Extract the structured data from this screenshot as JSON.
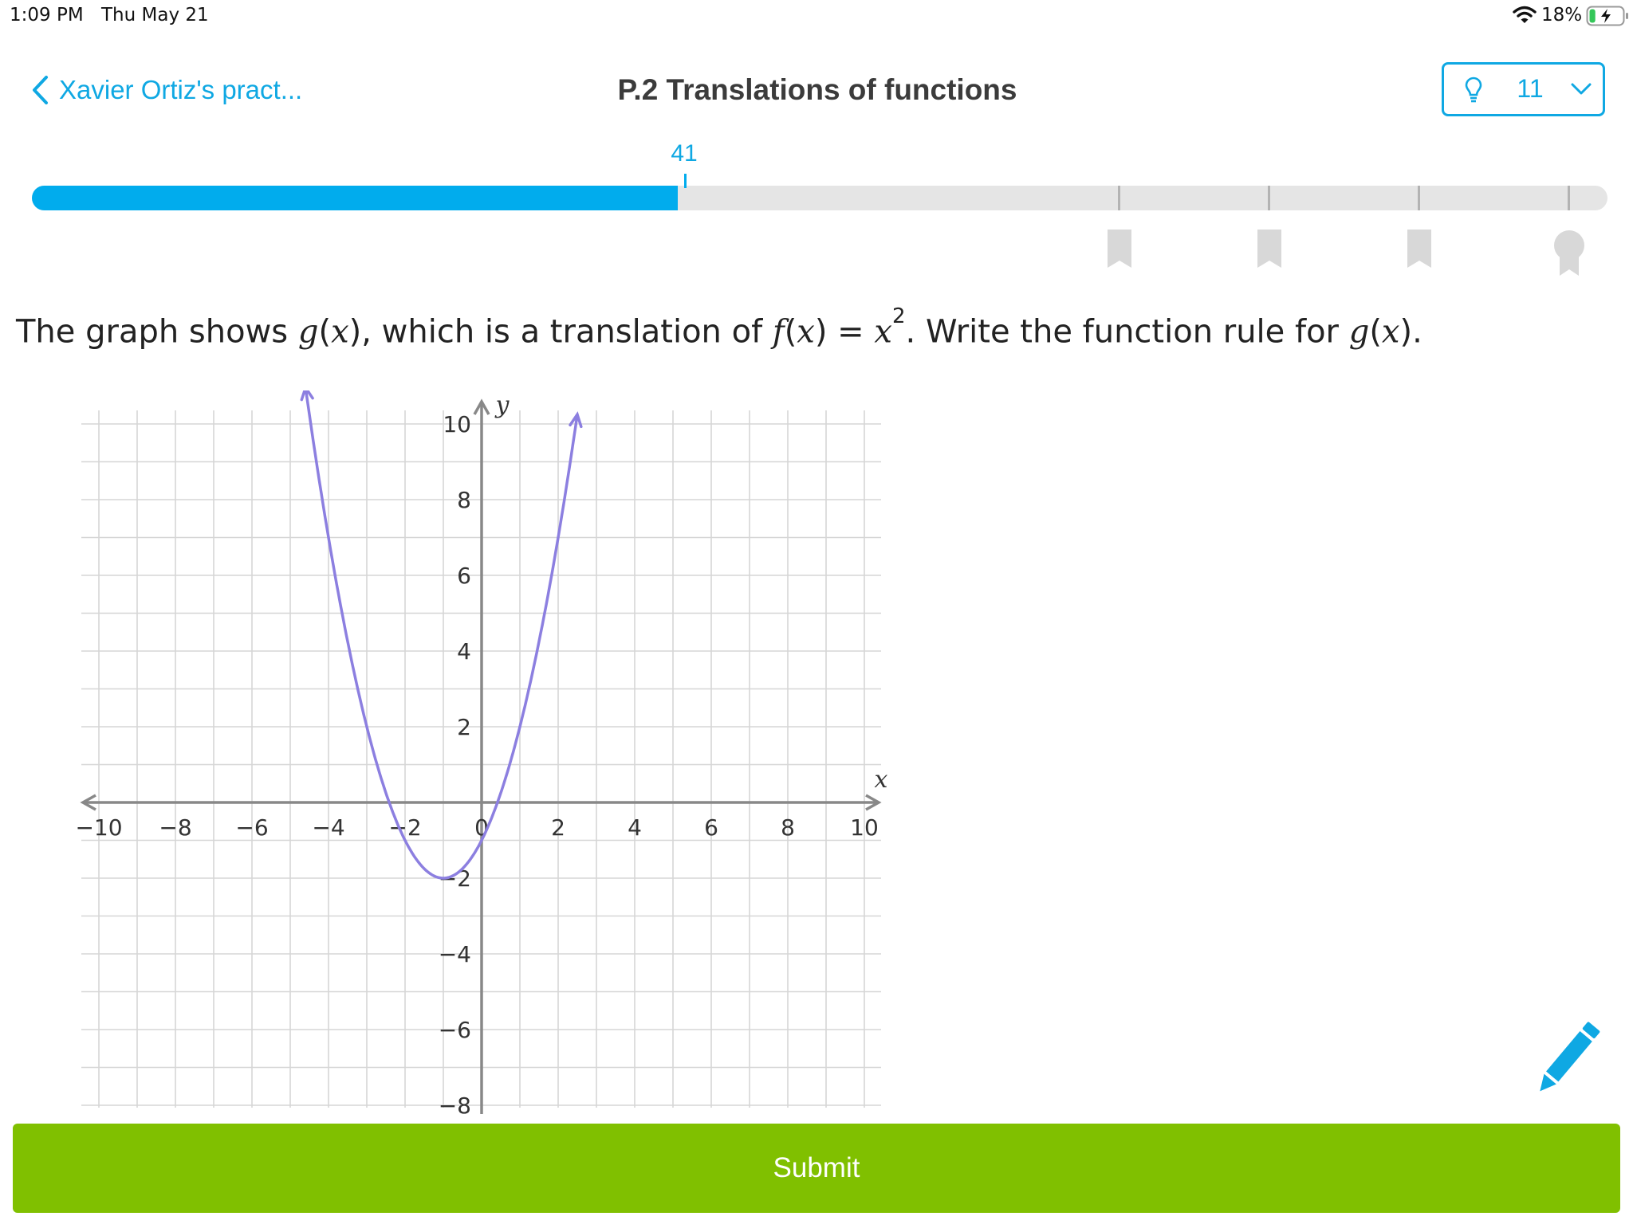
{
  "status_bar": {
    "time": "1:09 PM",
    "date": "Thu May 21",
    "battery_percent": "18%",
    "battery_level": 0.18,
    "charging": true
  },
  "header": {
    "back_label": "Xavier Ortiz's pract...",
    "title": "P.2 Translations of functions",
    "hint_count": "11",
    "hint_icon": "lightbulb-icon"
  },
  "progress": {
    "value": "41",
    "max": 100,
    "fraction": 0.41,
    "milestones": [
      "bookmark-icon",
      "bookmark-icon",
      "bookmark-icon",
      "award-ribbon-icon"
    ]
  },
  "question": {
    "p1": "The graph shows ",
    "g1": "g",
    "p2": "(",
    "x1": "x",
    "p3": "), which is a translation of ",
    "f": "f",
    "p4": "(",
    "x2": "x",
    "p5": ") = ",
    "x3": "x",
    "exp": "2",
    "p6": ". Write the function rule for ",
    "g2": "g",
    "p7": "(",
    "x4": "x",
    "p8": ")."
  },
  "chart_data": {
    "type": "line",
    "xlabel": "x",
    "ylabel": "y",
    "xlim": [
      -10,
      10
    ],
    "ylim": [
      -8,
      10
    ],
    "x_ticks": [
      "−10",
      "−8",
      "−6",
      "−4",
      "−2",
      "0",
      "2",
      "4",
      "6",
      "8",
      "10"
    ],
    "y_ticks": [
      "10",
      "8",
      "6",
      "4",
      "2",
      "−2",
      "−4",
      "−6",
      "−8"
    ],
    "grid": true,
    "series": [
      {
        "function": "(x+1)^2 - 2",
        "vertex": [
          -1,
          -2
        ],
        "x_range": [
          -4.6,
          2.5
        ],
        "color": "#8c7fe0",
        "points": [
          [
            -4.5,
            10.25
          ],
          [
            -4,
            7
          ],
          [
            -3,
            2
          ],
          [
            -2,
            -1
          ],
          [
            -1,
            -2
          ],
          [
            0,
            -1
          ],
          [
            1,
            2
          ],
          [
            2,
            7
          ],
          [
            2.5,
            10.25
          ]
        ]
      }
    ]
  },
  "submit_label": "Submit"
}
